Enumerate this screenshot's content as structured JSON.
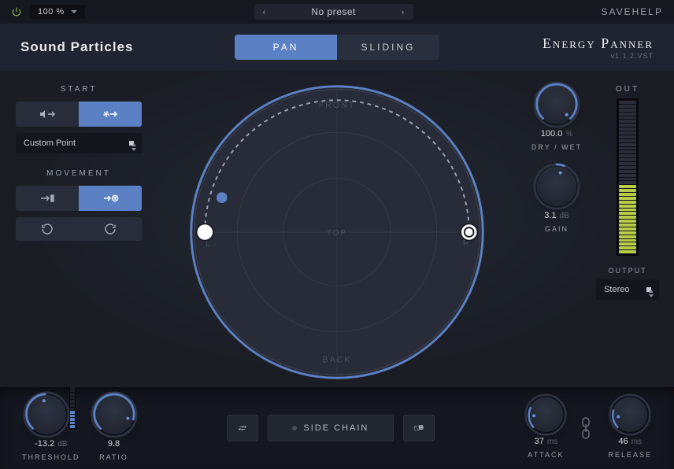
{
  "topbar": {
    "zoom": "100 %",
    "preset": "No preset",
    "save": "SAVE",
    "help": "HELP"
  },
  "header": {
    "brand": "Sound Particles",
    "modes": {
      "pan": "PAN",
      "sliding": "SLIDING"
    },
    "product": "Energy Panner",
    "version": "v1.1.2.VST"
  },
  "left": {
    "start_label": "START",
    "start_dropdown": "Custom Point",
    "movement_label": "MOVEMENT"
  },
  "circle_labels": {
    "front": "FRONT",
    "back": "BACK",
    "left": "L",
    "right": "R",
    "top": "TOP"
  },
  "right": {
    "drywet": {
      "value": "100.0",
      "unit": "%",
      "label": "DRY / WET"
    },
    "gain": {
      "value": "3.1",
      "unit": "dB",
      "label": "GAIN"
    },
    "out_label": "OUT",
    "output_label": "OUTPUT",
    "output_value": "Stereo"
  },
  "bottom": {
    "threshold": {
      "value": "-13.2",
      "unit": "dB",
      "label": "THRESHOLD"
    },
    "ratio": {
      "value": "9.8",
      "label": "RATIO"
    },
    "sidechain": "SIDE CHAIN",
    "attack": {
      "value": "37",
      "unit": "ms",
      "label": "ATTACK"
    },
    "release": {
      "value": "46",
      "unit": "ms",
      "label": "RELEASE"
    }
  },
  "colors": {
    "accent": "#5b80c3"
  }
}
